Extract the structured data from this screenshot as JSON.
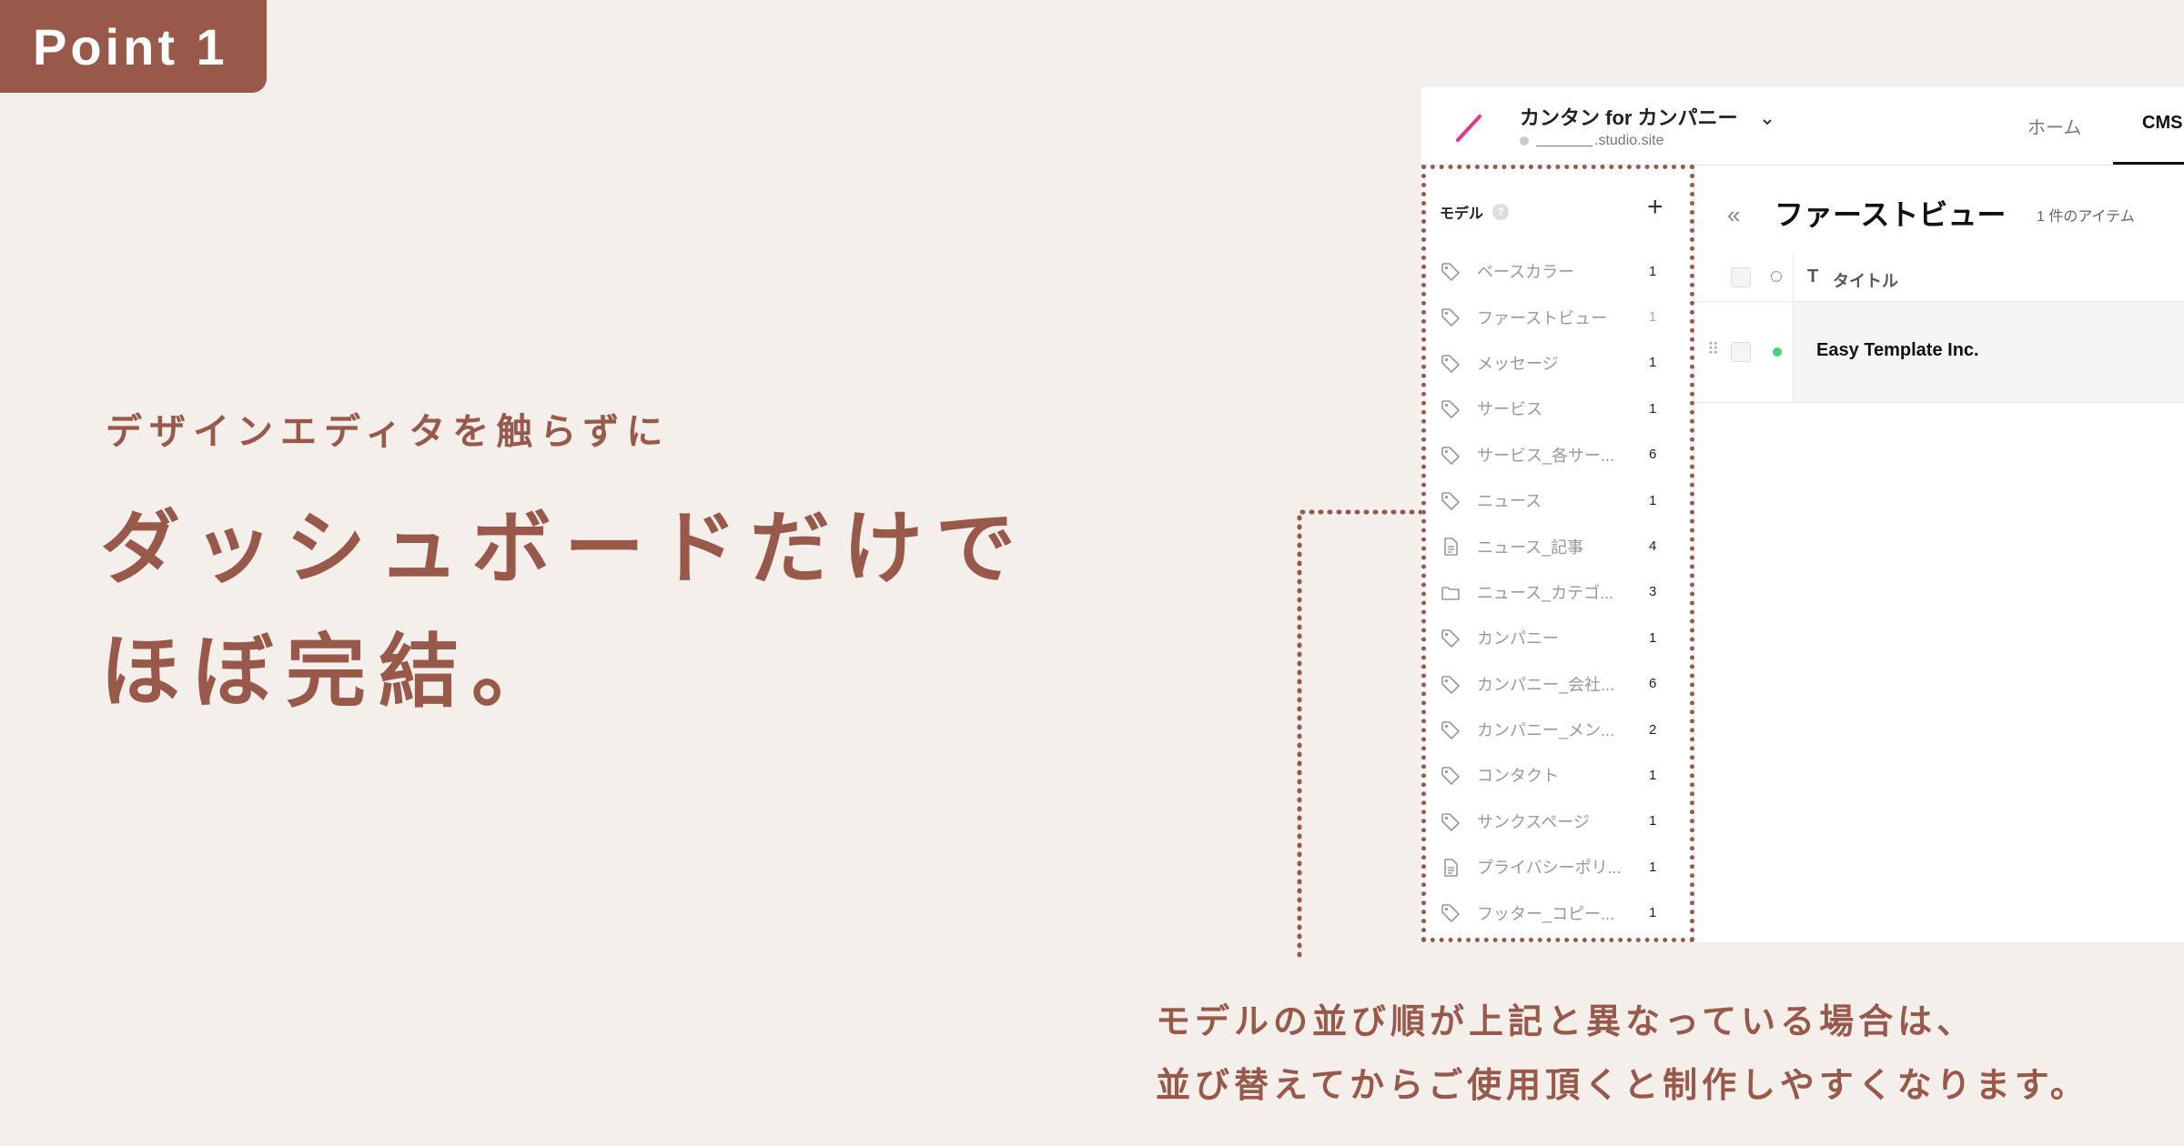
{
  "badge": {
    "label": "Point 1"
  },
  "headline": {
    "sub": "デザインエディタを触らずに",
    "line1": "ダッシュボードだけで",
    "line2": "ほぼ完結。"
  },
  "note": {
    "line1": "モデルの並び順が上記と異なっている場合は、",
    "line2": "並び替えてからご使用頂くと制作しやすくなります。"
  },
  "app": {
    "project_name": "カンタン for カンパニー",
    "project_url_suffix": ".studio.site",
    "nav": {
      "home": "ホーム",
      "cms": "CMS"
    },
    "sidebar": {
      "header": "モデル",
      "help": "?",
      "add": "+",
      "items": [
        {
          "icon": "tag-icon",
          "label": "ベースカラー",
          "count": "1"
        },
        {
          "icon": "tag-icon",
          "label": "ファーストビュー",
          "count": "1"
        },
        {
          "icon": "tag-icon",
          "label": "メッセージ",
          "count": "1"
        },
        {
          "icon": "tag-icon",
          "label": "サービス",
          "count": "1"
        },
        {
          "icon": "tag-icon",
          "label": "サービス_各サー...",
          "count": "6"
        },
        {
          "icon": "tag-icon",
          "label": "ニュース",
          "count": "1"
        },
        {
          "icon": "document-icon",
          "label": "ニュース_記事",
          "count": "4"
        },
        {
          "icon": "folder-icon",
          "label": "ニュース_カテゴ...",
          "count": "3"
        },
        {
          "icon": "tag-icon",
          "label": "カンパニー",
          "count": "1"
        },
        {
          "icon": "tag-icon",
          "label": "カンパニー_会社...",
          "count": "6"
        },
        {
          "icon": "tag-icon",
          "label": "カンパニー_メン...",
          "count": "2"
        },
        {
          "icon": "tag-icon",
          "label": "コンタクト",
          "count": "1"
        },
        {
          "icon": "tag-icon",
          "label": "サンクスページ",
          "count": "1"
        },
        {
          "icon": "document-icon",
          "label": "プライバシーポリ...",
          "count": "1"
        },
        {
          "icon": "tag-icon",
          "label": "フッター_コピー...",
          "count": "1"
        }
      ]
    },
    "content": {
      "collapse": "«",
      "title": "ファーストビュー",
      "item_count": "1 件のアイテム",
      "column_type": "T",
      "column_title": "タイトル",
      "rows": [
        {
          "title": "Easy Template Inc."
        }
      ]
    }
  },
  "colors": {
    "accent": "#98584a",
    "background": "#f5efec",
    "status_green": "#4cd07a",
    "logo": "#e6358c"
  }
}
